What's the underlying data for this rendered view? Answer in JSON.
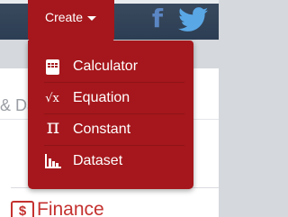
{
  "topbar": {
    "create_label": "Create",
    "facebook_icon": "facebook-icon",
    "twitter_icon": "twitter-icon",
    "facebook_glyph": "f"
  },
  "page": {
    "fragment_text": "& Da",
    "card_icon_glyph": "$",
    "card_label": "Finance"
  },
  "dropdown": {
    "items": [
      {
        "label": "Calculator",
        "icon": "calculator-icon"
      },
      {
        "label": "Equation",
        "icon": "square-root-icon",
        "glyph": "√x"
      },
      {
        "label": "Constant",
        "icon": "pi-icon",
        "glyph": "π"
      },
      {
        "label": "Dataset",
        "icon": "bar-chart-icon"
      }
    ]
  },
  "colors": {
    "brand_red": "#a5171c",
    "nav_dark": "#2c3e54",
    "facebook_blue": "#5b86c4",
    "twitter_blue": "#5aa7e6"
  }
}
